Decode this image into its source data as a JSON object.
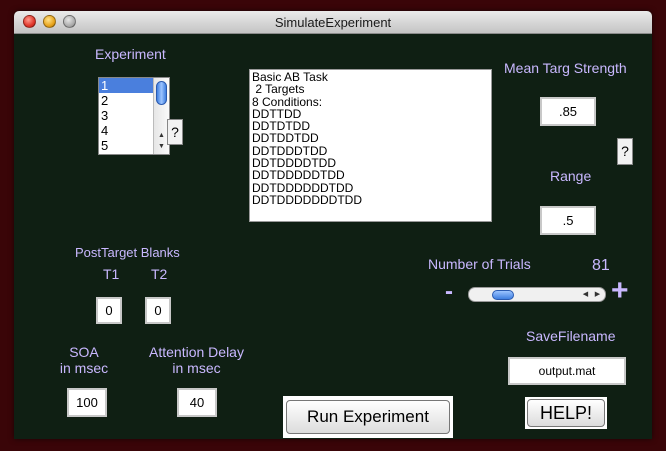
{
  "window": {
    "title": "SimulateExperiment"
  },
  "experiment": {
    "label": "Experiment",
    "items": [
      "1",
      "2",
      "3",
      "4",
      "5"
    ],
    "selected": "1",
    "help_label": "?"
  },
  "description": {
    "lines": [
      "Basic AB Task",
      " 2 Targets",
      "8 Conditions:",
      "DDTTDD",
      "DDTDTDD",
      "DDTDDTDD",
      "DDTDDDTDD",
      "DDTDDDDTDD",
      "DDTDDDDDTDD",
      "DDTDDDDDDTDD",
      "DDTDDDDDDDTDD"
    ]
  },
  "mean_target_strength": {
    "label": "Mean Targ Strength",
    "value": ".85"
  },
  "range": {
    "label": "Range",
    "value": ".5",
    "help_label": "?"
  },
  "num_trials": {
    "label": "Number of Trials",
    "value": "81",
    "minus": "-",
    "plus": "+",
    "slider_fraction": 0.25
  },
  "post_target_blanks": {
    "label": "PostTarget Blanks",
    "t1_label": "T1",
    "t2_label": "T2",
    "t1_value": "0",
    "t2_value": "0"
  },
  "soa": {
    "label_line1": "SOA",
    "label_line2": "in msec",
    "value": "100"
  },
  "attention_delay": {
    "label_line1": "Attention Delay",
    "label_line2": "in msec",
    "value": "40"
  },
  "save_filename": {
    "label": "SaveFilename",
    "value": "output.mat"
  },
  "buttons": {
    "run": "Run Experiment",
    "help": "HELP!"
  }
}
